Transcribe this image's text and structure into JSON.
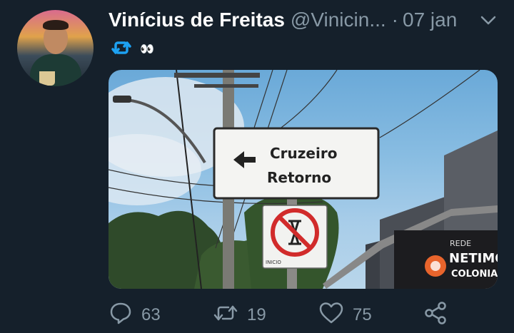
{
  "tweet": {
    "author_name": "Vinícius de Freitas",
    "handle": "@Vinicin...",
    "separator": "·",
    "date": "07 jan",
    "text": "👀",
    "text_icon": "retweet-icon"
  },
  "media": {
    "sign_main": [
      "Cruzeiro",
      "Retorno"
    ],
    "sign_small": "INICIO",
    "storefront": [
      "REDE",
      "NETIMÓV",
      "COLONIAL"
    ]
  },
  "actions": {
    "replies": "63",
    "retweets": "19",
    "likes": "75"
  },
  "colors": {
    "background": "#15202b",
    "muted": "#8899a6",
    "accent": "#1da1f2"
  }
}
